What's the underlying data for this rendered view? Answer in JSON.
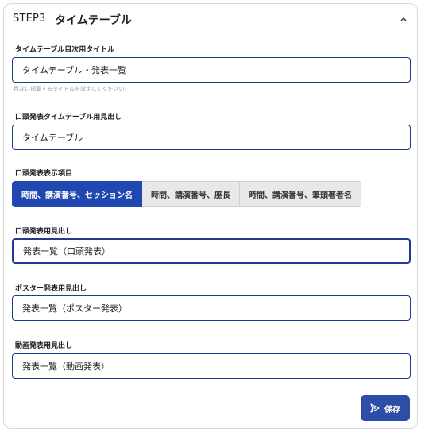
{
  "header": {
    "step": "STEP3",
    "title": "タイムテーブル"
  },
  "fields": {
    "timetable_title": {
      "label": "タイムテーブル目次用タイトル",
      "value": "タイムテーブル・発表一覧",
      "hint": "目次に掲載するタイトルを設定してください。"
    },
    "oral_timetable_heading": {
      "label": "口頭発表タイムテーブル用見出し",
      "value": "タイムテーブル"
    },
    "oral_display_items": {
      "label": "口頭発表表示項目",
      "options": [
        "時間、講演番号、セッション名",
        "時間、講演番号、座長",
        "時間、講演番号、筆頭著者名"
      ],
      "selected": "時間、講演番号、セッション名"
    },
    "oral_heading": {
      "label": "口頭発表用見出し",
      "value": "発表一覧（口頭発表）"
    },
    "poster_heading": {
      "label": "ポスター発表用見出し",
      "value": "発表一覧（ポスター発表）"
    },
    "video_heading": {
      "label": "動画発表用見出し",
      "value": "発表一覧（動画発表）"
    }
  },
  "actions": {
    "save_label": "保存",
    "save_icon": "send-icon"
  },
  "colors": {
    "accent": "#1f48b1",
    "field_border": "#1f3a93",
    "save_button": "#2c4ea6"
  }
}
